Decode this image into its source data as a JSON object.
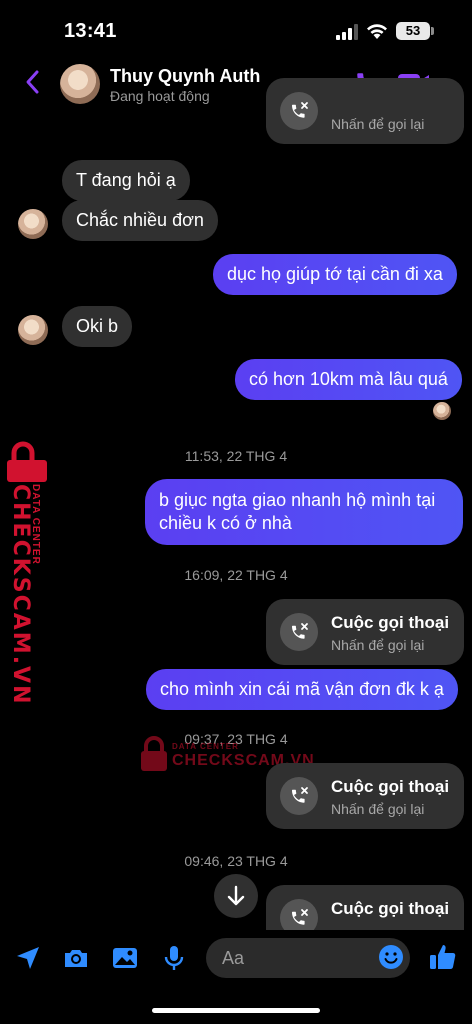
{
  "status_bar": {
    "time": "13:41",
    "battery": "53"
  },
  "header": {
    "contact_name": "Thuy Quynh Auth",
    "contact_status": "Đang hoạt động"
  },
  "messages": [
    {
      "from": "them",
      "text": "T đang hỏi ạ"
    },
    {
      "from": "them",
      "text": "Chắc nhiều đơn"
    },
    {
      "from": "me",
      "text": "dục họ giúp tớ tại cần đi xa"
    },
    {
      "from": "them",
      "text": "Oki b"
    },
    {
      "from": "me",
      "text": "có hơn 10km mà lâu quá"
    },
    {
      "from": "me",
      "line1": "b giục ngta giao nhanh hộ mình tại",
      "line2": "chiều k có ở nhà"
    },
    {
      "from": "me",
      "text": "cho mình xin cái mã vận đơn đk k ạ"
    }
  ],
  "timestamps": [
    "11:53, 22 THG 4",
    "16:09, 22 THG 4",
    "09:37, 23 THG 4",
    "09:46, 23 THG 4"
  ],
  "call": {
    "title": "Cuộc gọi thoại",
    "subtitle": "Nhấn để gọi lại"
  },
  "composer": {
    "placeholder": "Aa"
  },
  "watermark": {
    "brand": "CHECKSCAM.VN",
    "sub": "DATA CENTER"
  },
  "colors": {
    "accent": "#5146f2",
    "icon_blue": "#2f8cff",
    "header_purple": "#8a3ff5",
    "online": "#31d158",
    "watermark": "#d1122f"
  },
  "icons": [
    "back-arrow-icon",
    "phone-icon",
    "video-camera-icon",
    "missed-call-icon",
    "arrow-down-icon",
    "location-arrow-icon",
    "camera-icon",
    "image-icon",
    "microphone-icon",
    "emoji-icon",
    "thumbs-up-icon",
    "lock-icon"
  ]
}
